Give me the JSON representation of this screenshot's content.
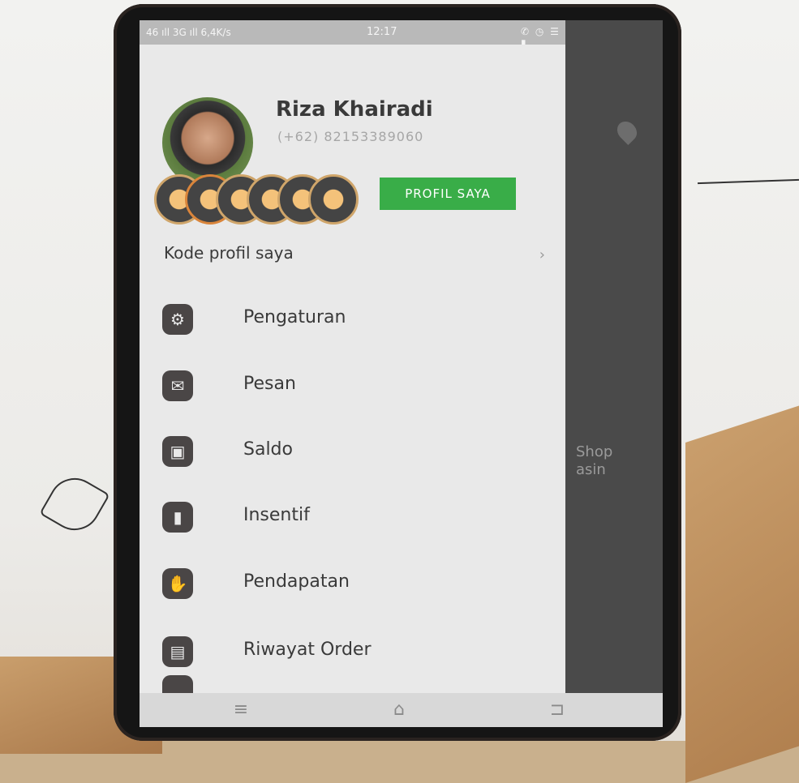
{
  "status_bar": {
    "left_text": "46 ıll 3G ıll 6,4K/s",
    "time": "12:17",
    "right_text": "✆ ◷ ☰ ▮"
  },
  "profile": {
    "name": "Riza Khairadi",
    "phone": "(+62) 82153389060",
    "button_label": "PROFIL SAYA"
  },
  "kode_profil": {
    "label": "Kode profil saya",
    "chevron": "›"
  },
  "menu": [
    {
      "label": "Pengaturan",
      "icon": "gear-icon",
      "glyph": "⚙"
    },
    {
      "label": "Pesan",
      "icon": "mail-icon",
      "glyph": "✉"
    },
    {
      "label": "Saldo",
      "icon": "wallet-icon",
      "glyph": "▣"
    },
    {
      "label": "Insentif",
      "icon": "bar-chart-icon",
      "glyph": "▮"
    },
    {
      "label": "Pendapatan",
      "icon": "hand-money-icon",
      "glyph": "✋"
    },
    {
      "label": "Riwayat Order",
      "icon": "briefcase-icon",
      "glyph": "▤"
    }
  ],
  "map_labels": [
    "Shop",
    "asin"
  ],
  "nav_bar": {
    "menu": "≡",
    "home": "⌂",
    "back": "⊐"
  },
  "colors": {
    "accent_green": "#39ad48",
    "drawer_bg": "#e9e9e9",
    "icon_bg": "#4a4646"
  }
}
